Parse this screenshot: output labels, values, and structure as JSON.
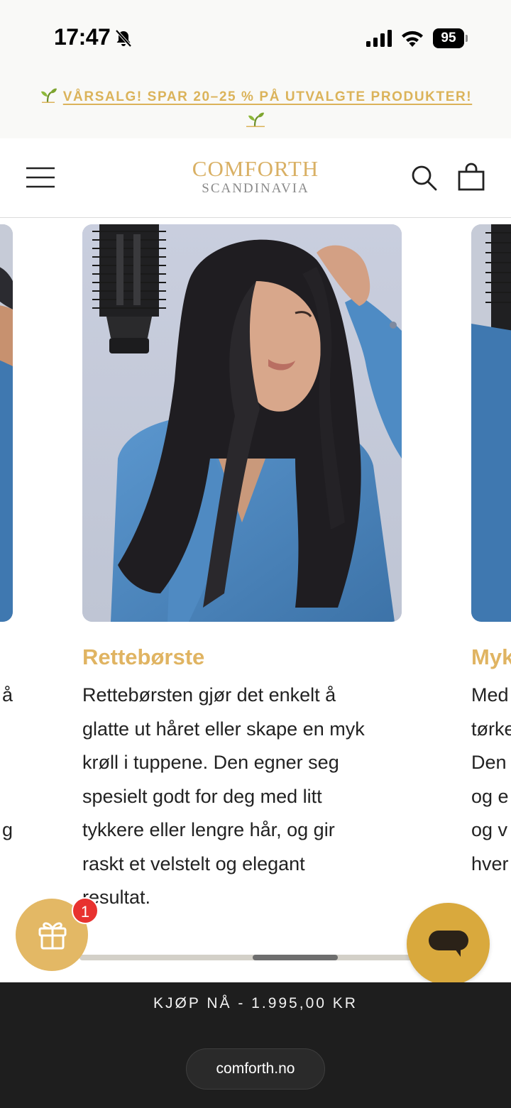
{
  "status_bar": {
    "time": "17:47",
    "battery": "95"
  },
  "announcement": {
    "line1": "VÅRSALG! SPAR 20–25 % PÅ UTVALGTE PRODUKTER!",
    "accent_color": "#dbb35a"
  },
  "header": {
    "logo_top": "COMFORTH",
    "logo_bottom": "SCANDINAVIA",
    "icons": [
      "menu-icon",
      "search-icon",
      "bag-icon"
    ]
  },
  "carousel": {
    "cards": [
      {
        "title": "",
        "lines": [
          "å",
          "",
          "",
          "",
          "g"
        ]
      },
      {
        "title": "Rettebørste",
        "lines": [
          "Rettebørsten gjør det enkelt å",
          "glatte ut håret eller skape en myk",
          "krøll i tuppene. Den egner seg",
          "spesielt godt for deg med litt",
          "tykkere eller lengre hår, og gir",
          "raskt et velstelt og elegant",
          "resultat."
        ]
      },
      {
        "title": "Myk",
        "lines": [
          "Med",
          "tørke",
          "Den",
          "og e",
          "og v",
          "hver"
        ]
      }
    ],
    "scroll_position": 0.5
  },
  "floating": {
    "gift_badge_count": "1",
    "gift_color": "#e3b865",
    "chat_color": "#d9a93d"
  },
  "buy_bar": {
    "label": "KJØP NÅ - 1.995,00 KR",
    "url": "comforth.no"
  }
}
